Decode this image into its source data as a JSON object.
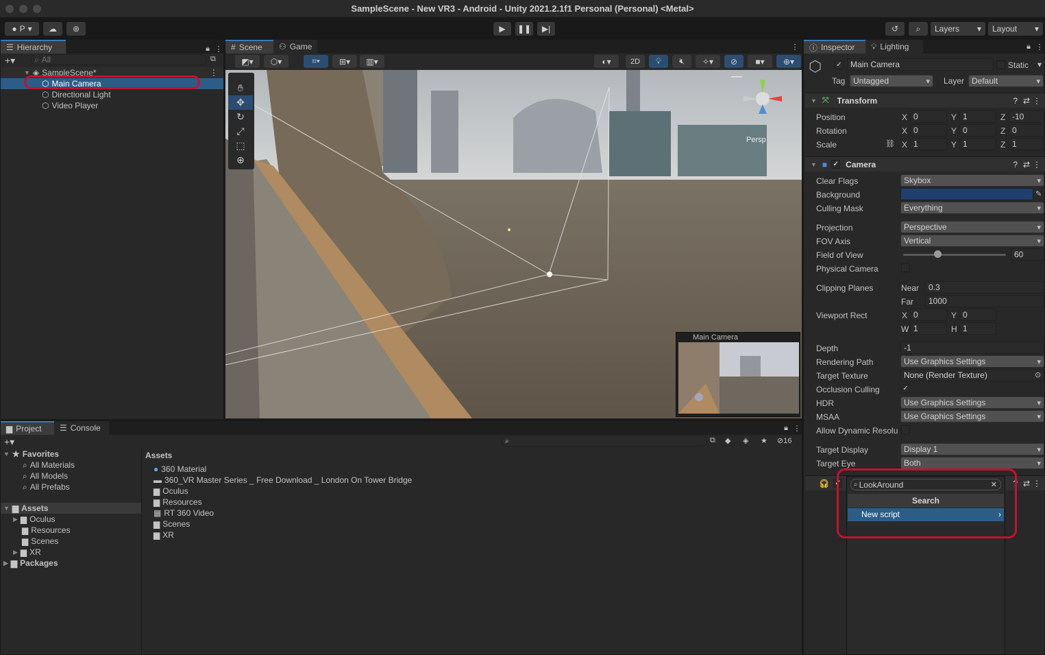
{
  "window": {
    "title": "SampleScene - New VR3 - Android - Unity 2021.2.1f1 Personal (Personal) <Metal>"
  },
  "toolbar": {
    "account": "P",
    "layers": "Layers",
    "layout": "Layout"
  },
  "hierarchy": {
    "tab": "Hierarchy",
    "search_placeholder": "All",
    "scene": "SampleScene*",
    "items": [
      "Main Camera",
      "Directional Light",
      "Video Player"
    ]
  },
  "scene_tabs": {
    "scene": "Scene",
    "game": "Game",
    "mode_2d": "2D"
  },
  "scene_view": {
    "persp_label": "Persp",
    "preview_title": "Main Camera"
  },
  "project": {
    "tabs": {
      "project": "Project",
      "console": "Console"
    },
    "hidden_count": "16",
    "favorites": {
      "label": "Favorites",
      "items": [
        "All Materials",
        "All Models",
        "All Prefabs"
      ]
    },
    "tree": {
      "assets": "Assets",
      "children": [
        "Oculus",
        "Resources",
        "Scenes",
        "XR"
      ],
      "packages": "Packages"
    },
    "assets_header": "Assets",
    "assets": [
      "360 Material",
      "360_VR Master Series _ Free Download _ London On Tower Bridge",
      "Oculus",
      "Resources",
      "RT 360 Video",
      "Scenes",
      "XR"
    ]
  },
  "inspector": {
    "tabs": {
      "inspector": "Inspector",
      "lighting": "Lighting"
    },
    "object_name": "Main Camera",
    "static_label": "Static",
    "tag_label": "Tag",
    "tag_value": "Untagged",
    "layer_label": "Layer",
    "layer_value": "Default",
    "transform": {
      "title": "Transform",
      "position": {
        "label": "Position",
        "x": "0",
        "y": "1",
        "z": "-10"
      },
      "rotation": {
        "label": "Rotation",
        "x": "0",
        "y": "0",
        "z": "0"
      },
      "scale": {
        "label": "Scale",
        "x": "1",
        "y": "1",
        "z": "1"
      }
    },
    "camera": {
      "title": "Camera",
      "clear_flags": {
        "label": "Clear Flags",
        "value": "Skybox"
      },
      "background": {
        "label": "Background",
        "color": "#1f3f6e"
      },
      "culling_mask": {
        "label": "Culling Mask",
        "value": "Everything"
      },
      "projection": {
        "label": "Projection",
        "value": "Perspective"
      },
      "fov_axis": {
        "label": "FOV Axis",
        "value": "Vertical"
      },
      "fov": {
        "label": "Field of View",
        "value": "60",
        "slider_fraction": 0.33
      },
      "physical_camera": {
        "label": "Physical Camera"
      },
      "clipping": {
        "label": "Clipping Planes",
        "near_label": "Near",
        "near": "0.3",
        "far_label": "Far",
        "far": "1000"
      },
      "viewport": {
        "label": "Viewport Rect",
        "x": "0",
        "y": "0",
        "w": "1",
        "h": "1"
      },
      "depth": {
        "label": "Depth",
        "value": "-1"
      },
      "rendering_path": {
        "label": "Rendering Path",
        "value": "Use Graphics Settings"
      },
      "target_texture": {
        "label": "Target Texture",
        "value": "None (Render Texture)"
      },
      "occlusion": {
        "label": "Occlusion Culling"
      },
      "hdr": {
        "label": "HDR",
        "value": "Use Graphics Settings"
      },
      "msaa": {
        "label": "MSAA",
        "value": "Use Graphics Settings"
      },
      "dynamic_res": {
        "label": "Allow Dynamic Resolu"
      },
      "target_display": {
        "label": "Target Display",
        "value": "Display 1"
      },
      "target_eye": {
        "label": "Target Eye",
        "value": "Both"
      }
    },
    "add_component": {
      "search_value": "LookAround",
      "header": "Search",
      "item": "New script"
    }
  },
  "axis": {
    "x": "X",
    "y": "Y",
    "z": "Z",
    "w": "W",
    "h": "H"
  }
}
